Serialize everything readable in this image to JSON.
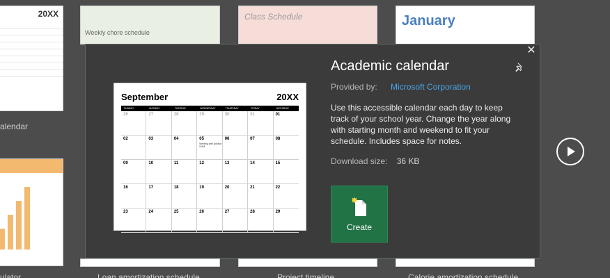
{
  "gallery": {
    "tiles": [
      {
        "id": "tile-calendar-left",
        "year": "20XX",
        "caption": "alendar"
      },
      {
        "id": "tile-chore",
        "heading": "Weekly chore schedule"
      },
      {
        "id": "tile-class",
        "heading": "Class Schedule"
      },
      {
        "id": "tile-january",
        "heading": "January"
      },
      {
        "id": "tile-calculator",
        "caption": "ulator"
      },
      {
        "id": "tile-loan",
        "caption": "Loan amortization schedule"
      },
      {
        "id": "tile-project",
        "caption": "Project timeline"
      },
      {
        "id": "tile-calorie",
        "caption": "Calorie amortization schedule"
      }
    ]
  },
  "modal": {
    "title": "Academic calendar",
    "provided_by_label": "Provided by:",
    "provider": "Microsoft Corporation",
    "description": "Use this accessible calendar each day to keep track of your school year. Change the year along with starting month and weekend to fit your schedule. Includes space for notes.",
    "download_size_label": "Download size:",
    "download_size": "36 KB",
    "create_label": "Create",
    "close_glyph": "✕",
    "icons": {
      "close": "close-icon",
      "pin": "pin-icon",
      "create": "new-document-icon",
      "next": "play-next-icon"
    },
    "accent_color": "#217346",
    "link_color": "#4aa5e8"
  },
  "preview": {
    "month": "September",
    "year": "20XX",
    "days": [
      "SUNDAY",
      "MONDAY",
      "TUESDAY",
      "WEDNESDAY",
      "THURSDAY",
      "FRIDAY",
      "SATURDAY"
    ],
    "weeks": [
      [
        {
          "d": "26",
          "dim": true
        },
        {
          "d": "27",
          "dim": true
        },
        {
          "d": "28",
          "dim": true
        },
        {
          "d": "29",
          "dim": true
        },
        {
          "d": "30",
          "dim": true
        },
        {
          "d": "31",
          "dim": true
        },
        {
          "d": "01"
        }
      ],
      [
        {
          "d": "02"
        },
        {
          "d": "03"
        },
        {
          "d": "04"
        },
        {
          "d": "05",
          "note": "Meeting with\nAdvisor 9 AM"
        },
        {
          "d": "06"
        },
        {
          "d": "07"
        },
        {
          "d": "08"
        }
      ],
      [
        {
          "d": "09"
        },
        {
          "d": "10"
        },
        {
          "d": "11"
        },
        {
          "d": "12"
        },
        {
          "d": "13"
        },
        {
          "d": "14"
        },
        {
          "d": "15"
        }
      ],
      [
        {
          "d": "16"
        },
        {
          "d": "17"
        },
        {
          "d": "18"
        },
        {
          "d": "19"
        },
        {
          "d": "20"
        },
        {
          "d": "21"
        },
        {
          "d": "22"
        }
      ],
      [
        {
          "d": "23"
        },
        {
          "d": "24"
        },
        {
          "d": "25"
        },
        {
          "d": "26"
        },
        {
          "d": "27"
        },
        {
          "d": "28"
        },
        {
          "d": "29"
        }
      ]
    ]
  }
}
